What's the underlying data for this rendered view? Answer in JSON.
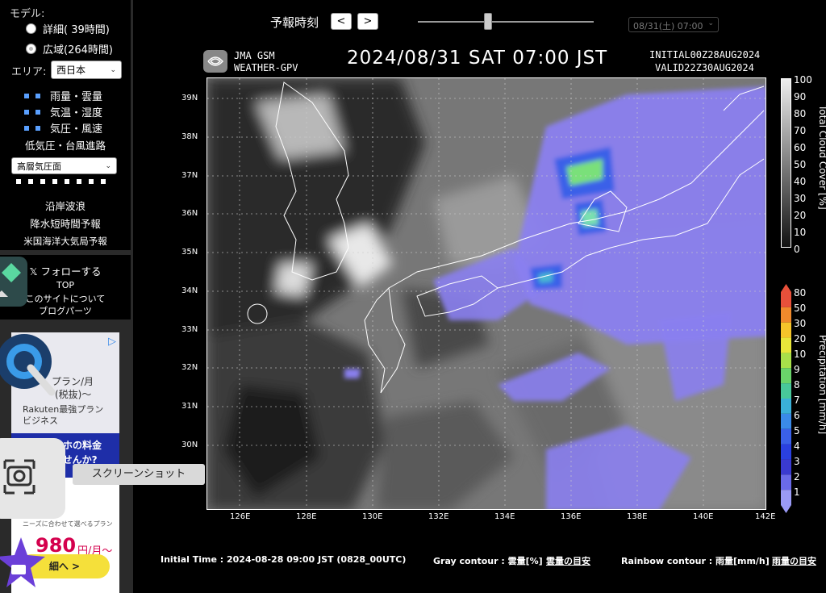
{
  "sidebar": {
    "model_label": "モデル:",
    "radio_detail": "詳細( 39時間)",
    "radio_wide": "広域(264時間)",
    "area_label": "エリア:",
    "area_value": "西日本",
    "layers": [
      "雨量・雲量",
      "気温・湿度",
      "気圧・風速"
    ],
    "layer_typhoon": "低気圧・台風進路",
    "upper_select": "高層気圧面",
    "links": [
      "沿岸波浪",
      "降水短時間予報",
      "米国海洋大気局予報"
    ],
    "follow": "フォローする",
    "top": "TOP",
    "about": "このサイトについて",
    "blog": "ブログパーツ"
  },
  "ad": {
    "line1": "プラン/月",
    "line2": "(税抜)〜",
    "line3": "Rakuten最強プラン",
    "line4": "ビジネス",
    "line5": "マホの料金",
    "line6": "ませんか?",
    "line7": "ニーズに合わせて選べるプラン",
    "price": "980",
    "unit": "円/月〜",
    "btn": "細へ >"
  },
  "controls": {
    "forecast_label": "予報時刻",
    "prev": "<",
    "next": ">",
    "time_value": "08/31(土) 07:00"
  },
  "header": {
    "model1": "JMA GSM",
    "model2": "WEATHER-GPV",
    "datetime": "2024/08/31 SAT  07:00 JST",
    "initial": "INITIAL00Z28AUG2024",
    "valid": "VALID22Z30AUG2024"
  },
  "map": {
    "lat_labels": [
      "39N",
      "38N",
      "37N",
      "36N",
      "35N",
      "34N",
      "33N",
      "32N",
      "31N",
      "30N"
    ],
    "lon_labels": [
      "126E",
      "128E",
      "130E",
      "132E",
      "134E",
      "136E",
      "138E",
      "140E",
      "142E"
    ]
  },
  "cloud_bar": {
    "title": "Total Cloud Cover [%]",
    "labels": [
      "100",
      "90",
      "80",
      "70",
      "60",
      "50",
      "40",
      "30",
      "20",
      "10",
      "0"
    ]
  },
  "precip_bar": {
    "title": "Precipitation [mm/h]",
    "labels": [
      "80",
      "50",
      "30",
      "20",
      "10",
      "9",
      "8",
      "7",
      "6",
      "5",
      "4",
      "3",
      "2",
      "1"
    ],
    "colors": [
      "#e8503a",
      "#f08a2c",
      "#f5c42a",
      "#e8e63a",
      "#a8e04a",
      "#6ad46a",
      "#48c89a",
      "#3ab0d8",
      "#3a8ae8",
      "#3a60e8",
      "#2a40e0",
      "#3a3ad0",
      "#6a6ae8",
      "#9a9af5"
    ]
  },
  "footer": {
    "initial_time": "Initial Time : 2024-08-28 09:00 JST (0828_00UTC)",
    "gray_label": "Gray contour : 雲量[%]",
    "gray_link": "雲量の目安",
    "rainbow_label": "Rainbow contour : 雨量[mm/h]",
    "rainbow_link": "雨量の目安"
  },
  "overlay": {
    "tooltip": "スクリーンショット"
  }
}
